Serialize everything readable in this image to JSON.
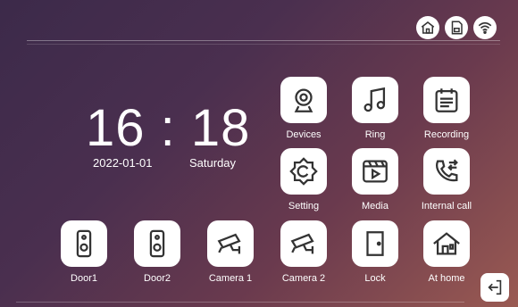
{
  "status_icons": [
    "home-status-icon",
    "sd-card-icon",
    "wifi-icon"
  ],
  "clock": {
    "time": "16 : 18",
    "date": "2022-01-01",
    "weekday": "Saturday"
  },
  "apps": [
    {
      "label": "Devices",
      "icon": "camera-icon"
    },
    {
      "label": "Ring",
      "icon": "music-note-icon"
    },
    {
      "label": "Recording",
      "icon": "recording-icon"
    },
    {
      "label": "Setting",
      "icon": "settings-icon"
    },
    {
      "label": "Media",
      "icon": "media-icon"
    },
    {
      "label": "Internal call",
      "icon": "phone-call-icon"
    }
  ],
  "bottom": [
    {
      "label": "Door1",
      "icon": "doorbell-icon"
    },
    {
      "label": "Door2",
      "icon": "doorbell-icon"
    },
    {
      "label": "Camera 1",
      "icon": "cctv-camera-icon"
    },
    {
      "label": "Camera 2",
      "icon": "cctv-camera-icon"
    },
    {
      "label": "Lock",
      "icon": "door-icon"
    },
    {
      "label": "At home",
      "icon": "house-icon"
    }
  ],
  "back_icon": "exit-icon"
}
